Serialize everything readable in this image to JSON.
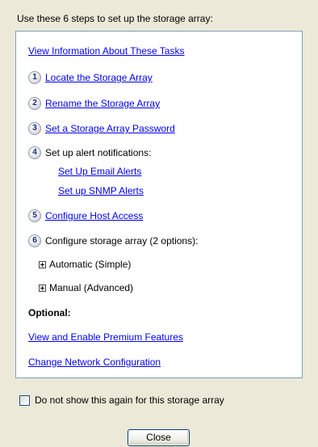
{
  "header": {
    "instruction": "Use these 6 steps to set up the storage array:"
  },
  "panel": {
    "info_link": "View Information About These Tasks",
    "steps": [
      {
        "number": "1",
        "label": "Locate the Storage Array"
      },
      {
        "number": "2",
        "label": "Rename the Storage Array"
      },
      {
        "number": "3",
        "label": "Set a Storage Array Password"
      },
      {
        "number": "4",
        "label": "Set up alert notifications:"
      },
      {
        "number": "5",
        "label": "Configure Host Access"
      },
      {
        "number": "6",
        "label": "Configure storage array (2 options):"
      }
    ],
    "alert_links": {
      "email": "Set Up Email Alerts",
      "snmp": "Set up SNMP Alerts"
    },
    "config_options": {
      "automatic": "Automatic (Simple)",
      "manual": "Manual (Advanced)"
    },
    "optional": {
      "heading": "Optional:",
      "premium_link": "View and Enable Premium Features",
      "network_link": "Change Network Configuration"
    }
  },
  "footer": {
    "checkbox_label": "Do not show this again for this storage array",
    "checkbox_checked": false,
    "close_label": "Close"
  }
}
